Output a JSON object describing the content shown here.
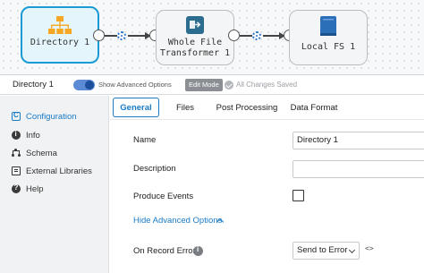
{
  "pipeline": {
    "stages": [
      {
        "name_line1": "Directory 1",
        "name_line2": "",
        "icon": "directory-origin-icon",
        "selected": true
      },
      {
        "name_line1": "Whole File",
        "name_line2": "Transformer 1",
        "icon": "transformer-icon",
        "selected": false
      },
      {
        "name_line1": "Local FS 1",
        "name_line2": "",
        "icon": "local-fs-icon",
        "selected": false
      }
    ]
  },
  "toolbar": {
    "stage_title": "Directory 1",
    "advanced_toggle_label": "Show Advanced Options",
    "advanced_toggle_on": true,
    "edit_mode_label": "Edit Mode",
    "saved_status": "All Changes Saved"
  },
  "sidenav": {
    "items": [
      {
        "label": "Configuration",
        "icon": "configuration-icon",
        "active": true
      },
      {
        "label": "Info",
        "icon": "info-icon",
        "active": false
      },
      {
        "label": "Schema",
        "icon": "schema-icon",
        "active": false
      },
      {
        "label": "External Libraries",
        "icon": "external-libraries-icon",
        "active": false
      },
      {
        "label": "Help",
        "icon": "help-icon",
        "active": false
      }
    ]
  },
  "tabs": [
    {
      "label": "General",
      "active": true
    },
    {
      "label": "Files",
      "active": false
    },
    {
      "label": "Post Processing",
      "active": false
    },
    {
      "label": "Data Format",
      "active": false
    }
  ],
  "form": {
    "name_label": "Name",
    "name_value": "Directory 1",
    "description_label": "Description",
    "description_value": "",
    "produce_events_label": "Produce Events",
    "produce_events_checked": false,
    "hide_advanced_label": "Hide Advanced Options",
    "on_record_error_label": "On Record Error",
    "on_record_error_value": "Send to Error",
    "code_toggle": "<>"
  },
  "colors": {
    "accent": "#1a7bc6",
    "selected_stage_border": "#1b9bd3",
    "selected_stage_fill": "#e4f5fb",
    "origin_icon": "#f5a623",
    "transformer_icon": "#2c6d8f",
    "destination_icon": "#2a6fb8"
  }
}
